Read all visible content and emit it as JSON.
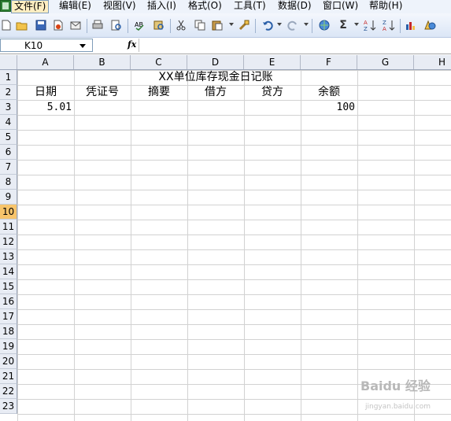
{
  "menu": {
    "items": [
      {
        "label": "文件(F)"
      },
      {
        "label": "编辑(E)"
      },
      {
        "label": "视图(V)"
      },
      {
        "label": "插入(I)"
      },
      {
        "label": "格式(O)"
      },
      {
        "label": "工具(T)"
      },
      {
        "label": "数据(D)"
      },
      {
        "label": "窗口(W)"
      },
      {
        "label": "帮助(H)"
      }
    ]
  },
  "toolbar": {
    "sum_glyph": "Σ"
  },
  "formula_bar": {
    "name_box": "K10",
    "fx_label": "fx",
    "formula": ""
  },
  "grid": {
    "columns": [
      "A",
      "B",
      "C",
      "D",
      "E",
      "F",
      "G",
      "H"
    ],
    "rows": [
      "1",
      "2",
      "3",
      "4",
      "5",
      "6",
      "7",
      "8",
      "9",
      "10",
      "11",
      "12",
      "13",
      "14",
      "15",
      "16",
      "17",
      "18",
      "19",
      "20",
      "21",
      "22",
      "23"
    ],
    "active_row": "10",
    "title": "XX单位库存现金日记账",
    "headers": [
      "日期",
      "凭证号",
      "摘要",
      "借方",
      "贷方",
      "余额"
    ],
    "row3": {
      "date": "5.01",
      "balance": "100"
    }
  },
  "watermark": {
    "text": "Baidu 经验",
    "sub": "jingyan.baidu.com"
  },
  "colors": {
    "menu_bg": "#eef3fb",
    "header_bg": "#e8ecf4",
    "active_row": "#f7c46b"
  }
}
